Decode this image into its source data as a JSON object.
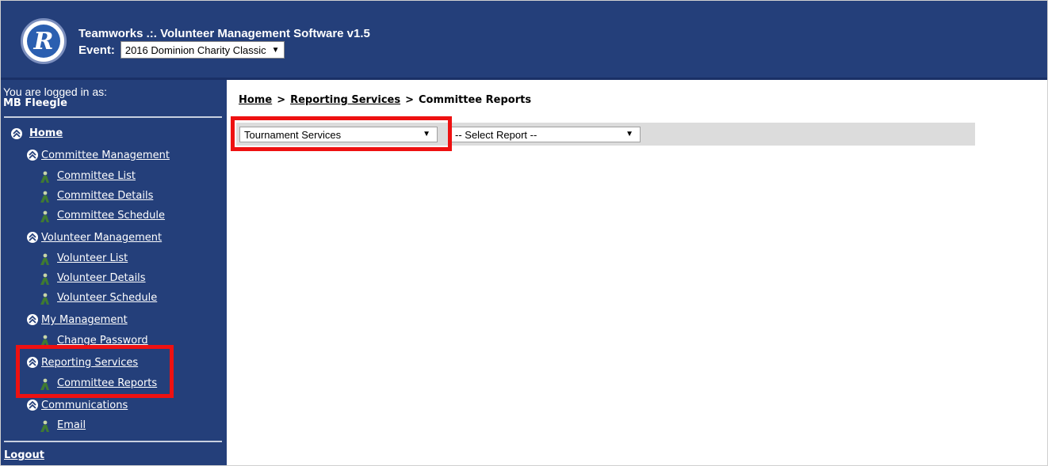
{
  "header": {
    "app_title": "Teamworks .:. Volunteer Management Software v1.5",
    "event_label": "Event:",
    "event_value": "2016 Dominion Charity Classic",
    "logo_icon": "r2-logo-icon"
  },
  "sidebar": {
    "logged_in_label": "You are logged in as:",
    "user_name": "MB Fleegle",
    "home": "Home",
    "sections": [
      {
        "label": "Committee Management",
        "items": [
          "Committee List",
          "Committee Details",
          "Committee Schedule"
        ]
      },
      {
        "label": "Volunteer Management",
        "items": [
          "Volunteer List",
          "Volunteer Details",
          "Volunteer Schedule"
        ]
      },
      {
        "label": "My Management",
        "items": [
          "Change Password"
        ]
      },
      {
        "label": "Reporting Services",
        "items": [
          "Committee Reports"
        ]
      },
      {
        "label": "Communications",
        "items": [
          "Email"
        ]
      }
    ],
    "logout": "Logout"
  },
  "main": {
    "breadcrumb": {
      "home": "Home",
      "sep": ">",
      "reporting": "Reporting Services",
      "current": "Committee Reports"
    },
    "category_select": "Tournament Services",
    "report_select": "-- Select Report --"
  },
  "colors": {
    "header_bg": "#243f7a",
    "sidebar_bg": "#243f7a",
    "highlight": "#ee1111",
    "filterbar_bg": "#dcdcdc"
  }
}
